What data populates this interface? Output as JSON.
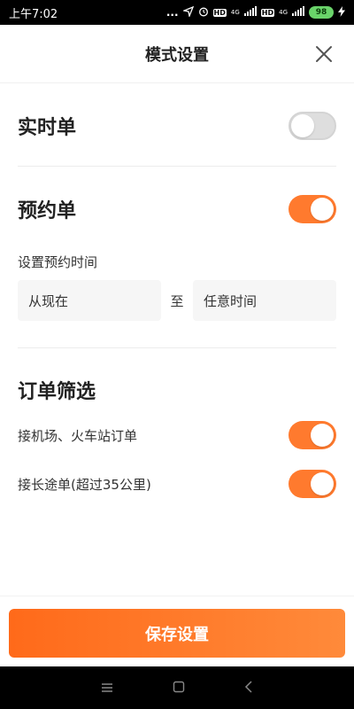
{
  "status_bar": {
    "time": "上午7:02",
    "dots": "...",
    "net1": "4G",
    "net2": "4G",
    "hd1": "HD",
    "hd2": "HD",
    "battery": "98"
  },
  "header": {
    "title": "模式设置"
  },
  "realtime": {
    "label": "实时单",
    "enabled": false
  },
  "reservation": {
    "label": "预约单",
    "enabled": true,
    "time_label": "设置预约时间",
    "from": "从现在",
    "separator": "至",
    "to": "任意时间"
  },
  "filter": {
    "title": "订单筛选",
    "items": [
      {
        "label": "接机场、火车站订单",
        "enabled": true
      },
      {
        "label": "接长途单(超过35公里)",
        "enabled": true
      }
    ]
  },
  "footer": {
    "save_label": "保存设置"
  },
  "colors": {
    "accent": "#ff7a2e"
  }
}
